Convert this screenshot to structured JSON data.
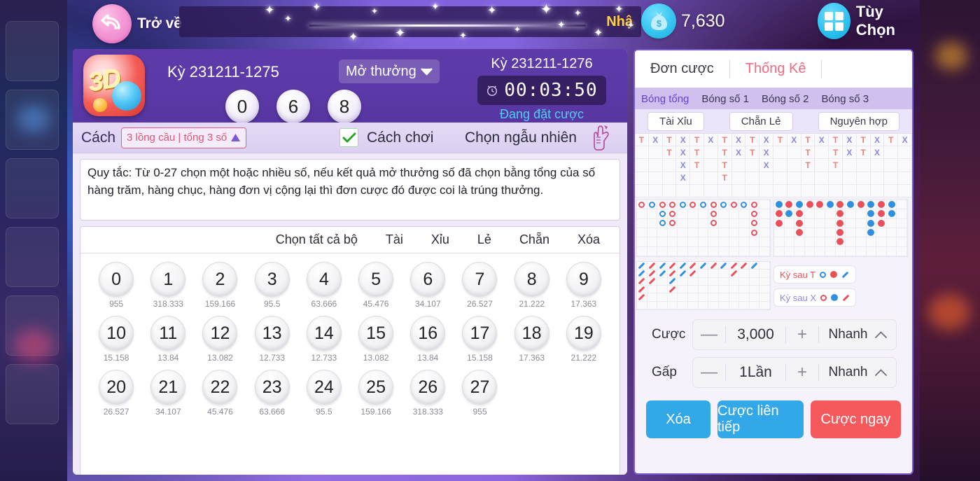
{
  "topbar": {
    "back_label": "Trở về",
    "back_icon": "undo-arrow-icon",
    "marquee_text": "Nhậ",
    "coin_icon": "money-bag-icon",
    "coin_amount": "7,630",
    "options_icon": "grid-squares-icon",
    "options_label": "Tùy Chọn"
  },
  "game_header": {
    "logo_text": "3D",
    "period_left": "Kỳ 231211-1275",
    "dropdown_label": "Mở thưởng",
    "dropdown_icon": "chevron-down-icon",
    "result_balls": [
      "0",
      "6",
      "8"
    ],
    "period_right": "Kỳ 231211-1276",
    "timer_icon": "alarm-clock-icon",
    "timer": "00:03:50",
    "bet_status": "Đang đặt cược"
  },
  "method_bar": {
    "label": "Cách",
    "chip_text": "3 lồng cầu | tổng 3 số",
    "chip_icon": "triangle-up-icon",
    "checkbox_icon": "check-icon",
    "checkbox_checked": true,
    "play_label": "Cách chơi",
    "random_label": "Chọn ngẫu nhiên",
    "random_icon": "hand-dice-icon"
  },
  "rules": {
    "text": "Quy tắc: Từ 0-27 chọn một hoặc nhiều số, nếu kết quả mở thưởng số đã chọn bằng tổng của số hàng trăm, hàng chục, hàng đơn vị cộng lại thì đơn cược đó được coi là trúng thưởng."
  },
  "selection": {
    "tools": [
      "Chọn tất cả bộ",
      "Tài",
      "Xỉu",
      "Lẻ",
      "Chẵn",
      "Xóa"
    ],
    "numbers": [
      {
        "n": "0",
        "odds": "955"
      },
      {
        "n": "1",
        "odds": "318.333"
      },
      {
        "n": "2",
        "odds": "159.166"
      },
      {
        "n": "3",
        "odds": "95.5"
      },
      {
        "n": "4",
        "odds": "63.666"
      },
      {
        "n": "5",
        "odds": "45.476"
      },
      {
        "n": "6",
        "odds": "34.107"
      },
      {
        "n": "7",
        "odds": "26.527"
      },
      {
        "n": "8",
        "odds": "21.222"
      },
      {
        "n": "9",
        "odds": "17.363"
      },
      {
        "n": "10",
        "odds": "15.158"
      },
      {
        "n": "11",
        "odds": "13.84"
      },
      {
        "n": "12",
        "odds": "13.082"
      },
      {
        "n": "13",
        "odds": "12.733"
      },
      {
        "n": "14",
        "odds": "12.733"
      },
      {
        "n": "15",
        "odds": "13.082"
      },
      {
        "n": "16",
        "odds": "13.84"
      },
      {
        "n": "17",
        "odds": "15.158"
      },
      {
        "n": "18",
        "odds": "17.363"
      },
      {
        "n": "19",
        "odds": "21.222"
      },
      {
        "n": "20",
        "odds": "26.527"
      },
      {
        "n": "21",
        "odds": "34.107"
      },
      {
        "n": "22",
        "odds": "45.476"
      },
      {
        "n": "23",
        "odds": "63.666"
      },
      {
        "n": "24",
        "odds": "95.5"
      },
      {
        "n": "25",
        "odds": "159.166"
      },
      {
        "n": "26",
        "odds": "318.333"
      },
      {
        "n": "27",
        "odds": "955"
      }
    ]
  },
  "stats_panel": {
    "tabs": [
      {
        "label": "Đơn cược",
        "active": false
      },
      {
        "label": "Thống Kê",
        "active": true
      }
    ],
    "ball_tabs": [
      {
        "label": "Bóng tổng",
        "active": true
      },
      {
        "label": "Bóng số 1",
        "active": false
      },
      {
        "label": "Bóng số 2",
        "active": false
      },
      {
        "label": "Bóng số 3",
        "active": false
      }
    ],
    "mode_chips": [
      "Tài Xỉu",
      "Chẵn Lẻ",
      "Nguyên hợp"
    ],
    "tx_grid": {
      "cols": 20,
      "rows": 5,
      "columns": [
        [
          "T"
        ],
        [
          "X"
        ],
        [
          "T",
          "T"
        ],
        [
          "X",
          "X",
          "X",
          "X"
        ],
        [
          "T",
          "T",
          "T"
        ],
        [
          "X"
        ],
        [
          "T",
          "T",
          "T",
          "T"
        ],
        [
          "X",
          "X"
        ],
        [
          "T",
          "T"
        ],
        [
          "X",
          "X",
          "X"
        ],
        [
          "T"
        ],
        [
          "X"
        ],
        [
          "T",
          "T",
          "T"
        ],
        [
          "X"
        ],
        [
          "T",
          "T",
          "T"
        ],
        [
          "X",
          "X"
        ],
        [
          "T",
          "T"
        ],
        [
          "X",
          "X"
        ],
        [
          "T"
        ],
        [
          "X"
        ]
      ]
    },
    "road_small_left": {
      "cols": 13,
      "rows": 6,
      "columns": [
        [
          "ring-red"
        ],
        [
          "ring-blue"
        ],
        [
          "ring-red",
          "ring-blue",
          "ring-blue"
        ],
        [
          "ring-red",
          "ring-red",
          "ring-red"
        ],
        [
          "ring-blue"
        ],
        [
          "ring-red"
        ],
        [
          "ring-blue"
        ],
        [
          "ring-red",
          "ring-red",
          "ring-red"
        ],
        [
          "ring-blue"
        ],
        [
          "ring-red"
        ],
        [
          "ring-blue"
        ],
        [
          "ring-red",
          "ring-red",
          "ring-red",
          "ring-red"
        ]
      ]
    },
    "road_small_right": {
      "cols": 13,
      "rows": 6,
      "columns": [
        [
          "dot-blue",
          "dot-red",
          "dot-red"
        ],
        [
          "dot-red",
          "dot-blue"
        ],
        [
          "dot-blue",
          "dot-red",
          "dot-red",
          "dot-red"
        ],
        [
          "dot-red"
        ],
        [
          "dot-red"
        ],
        [
          "dot-blue"
        ],
        [
          "dot-red",
          "dot-red",
          "dot-red",
          "dot-red",
          "dot-red"
        ],
        [
          "dot-blue"
        ],
        [
          "dot-red"
        ],
        [
          "dot-blue",
          "dot-blue",
          "dot-blue",
          "dot-blue"
        ],
        [
          "dot-red",
          "dot-red",
          "dot-red"
        ],
        [
          "dot-blue",
          "dot-blue"
        ]
      ]
    },
    "road_slash": {
      "cols": 13,
      "rows": 6,
      "columns": [
        [
          "slash-blue",
          "slash-blue",
          "slash-red",
          "slash-red",
          "slash-red"
        ],
        [
          "slash-red",
          "slash-red",
          "slash-red"
        ],
        [
          "slash-blue",
          "slash-blue"
        ],
        [
          "slash-red",
          "slash-red",
          "slash-blue",
          "slash-red"
        ],
        [
          "slash-blue",
          "slash-blue"
        ],
        [
          "slash-red",
          "slash-red"
        ],
        [
          "slash-blue"
        ],
        [
          "slash-red"
        ],
        [
          "slash-blue"
        ],
        [
          "slash-red",
          "slash-red"
        ],
        [
          "slash-red"
        ],
        [
          "slash-blue"
        ]
      ]
    },
    "legend": [
      {
        "label": "Kỳ sau T",
        "color": "#e8505a",
        "markers": [
          "ring-blue",
          "dot-red",
          "slash-blue"
        ]
      },
      {
        "label": "Kỳ sau X",
        "color": "#8a8ad8",
        "markers": [
          "ring-red",
          "dot-blue",
          "slash-red"
        ]
      }
    ]
  },
  "bet_controls": {
    "bet": {
      "label": "Cược",
      "minus": "—",
      "value": "3,000",
      "plus": "+",
      "fast_label": "Nhanh",
      "fast_icon": "chevron-up-icon"
    },
    "multiplier": {
      "label": "Gấp",
      "minus": "—",
      "value": "1Lần",
      "plus": "+",
      "fast_label": "Nhanh",
      "fast_icon": "chevron-up-icon"
    },
    "actions": [
      {
        "label": "Xóa",
        "color": "#32a8e8"
      },
      {
        "label": "Cược liên tiếp",
        "color": "#32a8e8"
      },
      {
        "label": "Cược ngay",
        "color": "#f5595c"
      }
    ]
  },
  "colors": {
    "accent_purple": "#7a5ad0",
    "header_purple": "#5b39a6",
    "pink_accent": "#f4697f",
    "blue_button": "#32a8e8",
    "red_button": "#f5595c",
    "timer_cyan": "#4dd0f5"
  }
}
